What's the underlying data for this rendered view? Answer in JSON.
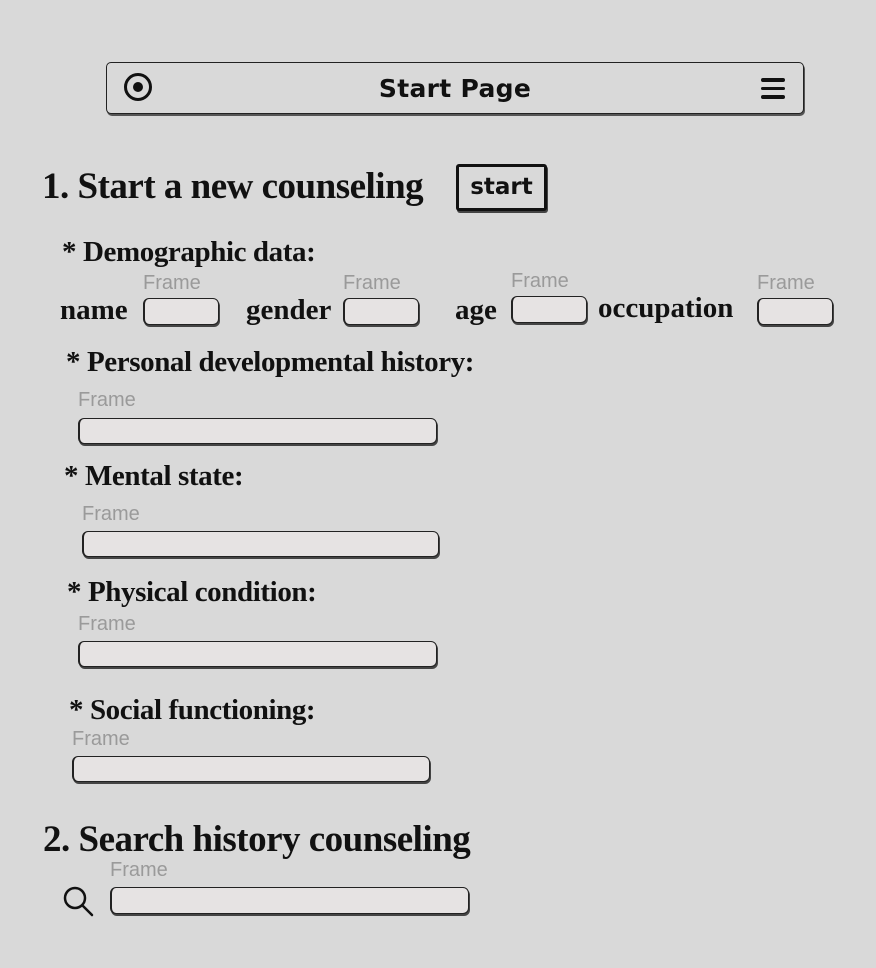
{
  "header": {
    "title": "Start Page",
    "left_icon": "radio-icon",
    "right_icon": "menu-icon"
  },
  "section1": {
    "title": "1. Start a new counseling",
    "start_button": "start"
  },
  "demographic": {
    "title": "* Demographic data:",
    "fields": [
      {
        "label": "name",
        "caption": "Frame",
        "value": ""
      },
      {
        "label": "gender",
        "caption": "Frame",
        "value": ""
      },
      {
        "label": "age",
        "caption": "Frame",
        "value": ""
      },
      {
        "label": "occupation",
        "caption": "Frame",
        "value": ""
      }
    ]
  },
  "history": {
    "title": "* Personal developmental history:",
    "caption": "Frame",
    "value": ""
  },
  "mental": {
    "title": "* Mental state:",
    "caption": "Frame",
    "value": ""
  },
  "physical": {
    "title": "* Physical condition:",
    "caption": "Frame",
    "value": ""
  },
  "social": {
    "title": "* Social functioning:",
    "caption": "Frame",
    "value": ""
  },
  "section2": {
    "title": "2. Search history counseling",
    "caption": "Frame",
    "value": "",
    "icon": "search-icon"
  }
}
